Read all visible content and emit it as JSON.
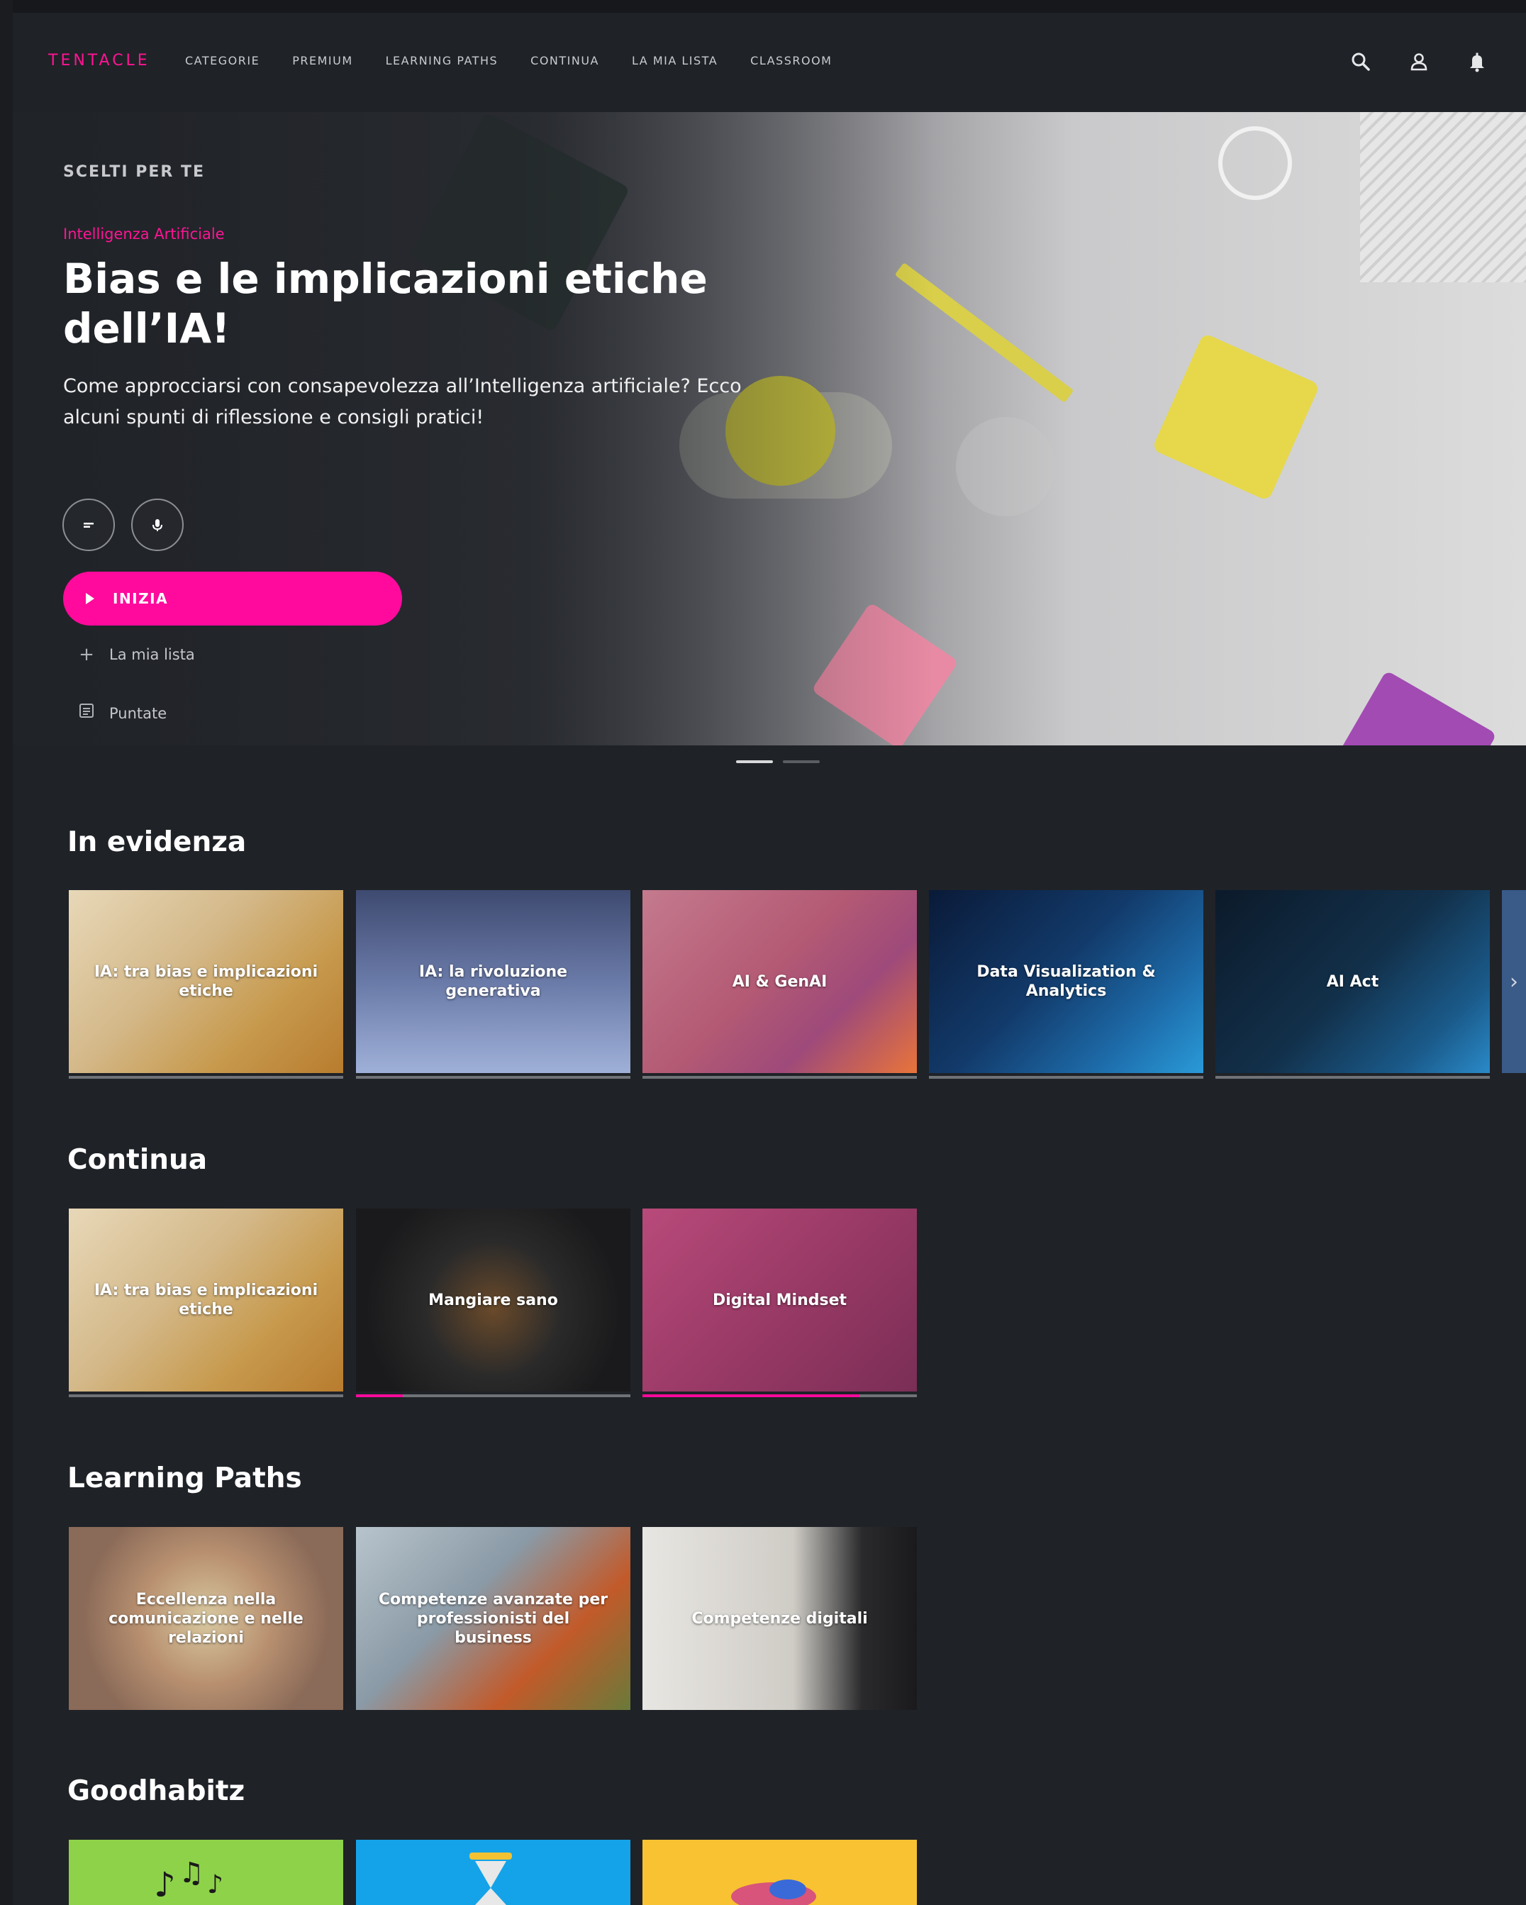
{
  "nav": {
    "logo": "TENTACLE",
    "menu": [
      "CATEGORIE",
      "PREMIUM",
      "LEARNING PATHS",
      "CONTINUA",
      "LA MIA LISTA",
      "CLASSROOM"
    ],
    "icons": [
      "search-icon",
      "user-icon",
      "bell-icon"
    ]
  },
  "hero": {
    "eyebrow": "SCELTI PER TE",
    "category": "Intelligenza Artificiale",
    "title": "Bias e le implicazioni etiche dell’IA!",
    "description": "Come approcciarsi con consapevolezza all’Intelligenza artificiale? Ecco alcuni spunti di riflessione e consigli pratici!",
    "start_label": "INIZIA",
    "list_label": "La mia lista",
    "episodes_label": "Puntate",
    "slide_count": 2,
    "active_slide": 1
  },
  "sections": {
    "featured": {
      "title": "In evidenza",
      "cards": [
        {
          "label": "IA: tra bias e implicazioni etiche"
        },
        {
          "label": "IA: la rivoluzione generativa"
        },
        {
          "label": "AI & GenAI"
        },
        {
          "label": "Data Visualization & Analytics"
        },
        {
          "label": "AI Act"
        }
      ]
    },
    "continue": {
      "title": "Continua",
      "cards": [
        {
          "label": "IA: tra bias e implicazioni etiche",
          "progress": 0.0
        },
        {
          "label": "Mangiare sano",
          "progress": 0.17
        },
        {
          "label": "Digital Mindset",
          "progress": 0.79
        }
      ]
    },
    "paths": {
      "title": "Learning Paths",
      "cards": [
        {
          "label": "Eccellenza nella comunicazione e nelle relazioni"
        },
        {
          "label": "Competenze avanzate per professionisti del business"
        },
        {
          "label": "Competenze digitali"
        }
      ]
    },
    "goodhabitz": {
      "title": "Goodhabitz"
    }
  },
  "colors": {
    "accent": "#ff0a9c",
    "background": "#1f2227"
  }
}
